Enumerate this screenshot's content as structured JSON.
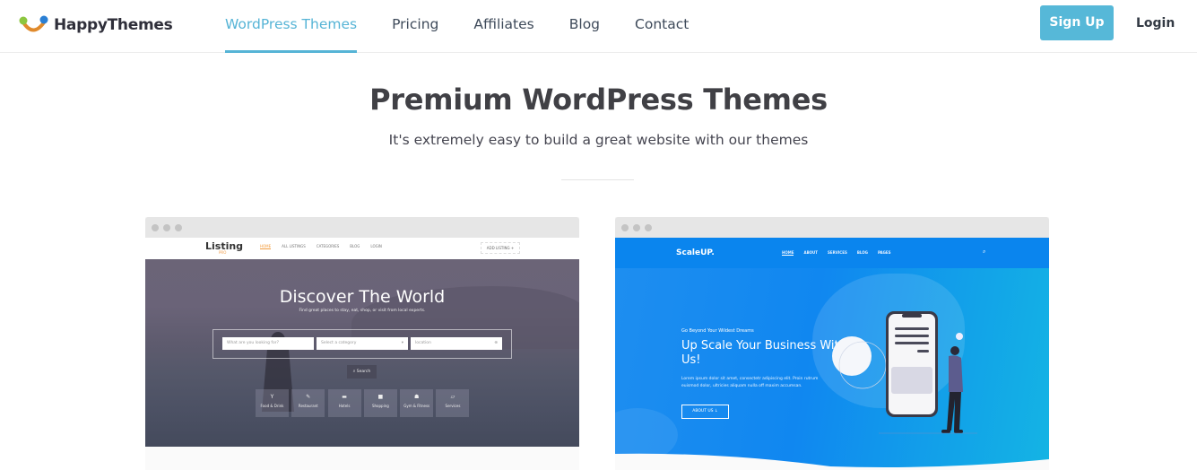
{
  "header": {
    "brand": "HappyThemes",
    "logo_icon": "smile-logo-icon",
    "nav": [
      {
        "label": "WordPress Themes",
        "active": true
      },
      {
        "label": "Pricing",
        "active": false
      },
      {
        "label": "Affiliates",
        "active": false
      },
      {
        "label": "Blog",
        "active": false
      },
      {
        "label": "Contact",
        "active": false
      }
    ],
    "signup_label": "Sign Up",
    "login_label": "Login"
  },
  "hero": {
    "title": "Premium WordPress Themes",
    "subtitle": "It's extremely easy to build a great website with our themes"
  },
  "colors": {
    "accent": "#56b4d6",
    "heading": "#404045",
    "scaleup_blue": "#0a85ee"
  },
  "themes": [
    {
      "name": "Listing",
      "logo": "Listing",
      "logo_sub": "PRO",
      "nav": [
        "HOME",
        "ALL LISTINGS",
        "CATEGORIES",
        "BLOG",
        "LOGIN"
      ],
      "add_listing": "ADD LISTING +",
      "headline": "Discover The World",
      "tagline": "Find great places to stay, eat, shop, or visit from local experts.",
      "search_placeholder": "What are you looking for?",
      "category_placeholder": "Select a category",
      "location_placeholder": "location",
      "search_button": "Search",
      "categories": [
        {
          "label": "Food & Drink",
          "icon": "cocktail-icon"
        },
        {
          "label": "Restaurant",
          "icon": "utensils-icon"
        },
        {
          "label": "Hotels",
          "icon": "bed-icon"
        },
        {
          "label": "Shopping",
          "icon": "shopping-bag-icon"
        },
        {
          "label": "Gym & Fitness",
          "icon": "dumbbell-icon"
        },
        {
          "label": "Services",
          "icon": "chat-icon"
        }
      ]
    },
    {
      "name": "ScaleUP",
      "logo": "ScaleUP.",
      "nav": [
        "HOME",
        "ABOUT",
        "SERVICES",
        "BLOG",
        "PAGES"
      ],
      "kicker": "Go Beyond Your Wildest Dreams",
      "headline": "Up Scale Your Business With Us!",
      "body": "Lorem ipsum dolor sit amet, consectetr adipiscing elit. Proin rutrum euismod dolor, ultricies aliquam nulla off maxim accumsan.",
      "button": "ABOUT US  ↓"
    }
  ]
}
